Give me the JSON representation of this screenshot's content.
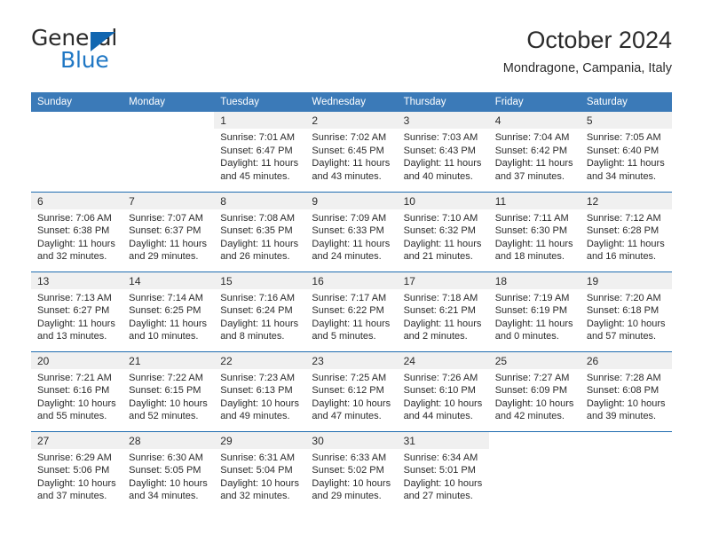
{
  "brand": {
    "name_part1": "General",
    "name_part2": "Blue",
    "triangle_color": "#1166b0",
    "blue_color": "#1f77c4"
  },
  "header": {
    "month_title": "October 2024",
    "location": "Mondragone, Campania, Italy"
  },
  "theme": {
    "header_blue": "#3b7ab8",
    "week_separator": "#1f6cb0",
    "daynum_band": "#f0f0f0"
  },
  "weekday_headers": [
    "Sunday",
    "Monday",
    "Tuesday",
    "Wednesday",
    "Thursday",
    "Friday",
    "Saturday"
  ],
  "weeks": [
    [
      {
        "day": "",
        "sunrise": "",
        "sunset": "",
        "daylight1": "",
        "daylight2": ""
      },
      {
        "day": "",
        "sunrise": "",
        "sunset": "",
        "daylight1": "",
        "daylight2": ""
      },
      {
        "day": "1",
        "sunrise": "Sunrise: 7:01 AM",
        "sunset": "Sunset: 6:47 PM",
        "daylight1": "Daylight: 11 hours",
        "daylight2": "and 45 minutes."
      },
      {
        "day": "2",
        "sunrise": "Sunrise: 7:02 AM",
        "sunset": "Sunset: 6:45 PM",
        "daylight1": "Daylight: 11 hours",
        "daylight2": "and 43 minutes."
      },
      {
        "day": "3",
        "sunrise": "Sunrise: 7:03 AM",
        "sunset": "Sunset: 6:43 PM",
        "daylight1": "Daylight: 11 hours",
        "daylight2": "and 40 minutes."
      },
      {
        "day": "4",
        "sunrise": "Sunrise: 7:04 AM",
        "sunset": "Sunset: 6:42 PM",
        "daylight1": "Daylight: 11 hours",
        "daylight2": "and 37 minutes."
      },
      {
        "day": "5",
        "sunrise": "Sunrise: 7:05 AM",
        "sunset": "Sunset: 6:40 PM",
        "daylight1": "Daylight: 11 hours",
        "daylight2": "and 34 minutes."
      }
    ],
    [
      {
        "day": "6",
        "sunrise": "Sunrise: 7:06 AM",
        "sunset": "Sunset: 6:38 PM",
        "daylight1": "Daylight: 11 hours",
        "daylight2": "and 32 minutes."
      },
      {
        "day": "7",
        "sunrise": "Sunrise: 7:07 AM",
        "sunset": "Sunset: 6:37 PM",
        "daylight1": "Daylight: 11 hours",
        "daylight2": "and 29 minutes."
      },
      {
        "day": "8",
        "sunrise": "Sunrise: 7:08 AM",
        "sunset": "Sunset: 6:35 PM",
        "daylight1": "Daylight: 11 hours",
        "daylight2": "and 26 minutes."
      },
      {
        "day": "9",
        "sunrise": "Sunrise: 7:09 AM",
        "sunset": "Sunset: 6:33 PM",
        "daylight1": "Daylight: 11 hours",
        "daylight2": "and 24 minutes."
      },
      {
        "day": "10",
        "sunrise": "Sunrise: 7:10 AM",
        "sunset": "Sunset: 6:32 PM",
        "daylight1": "Daylight: 11 hours",
        "daylight2": "and 21 minutes."
      },
      {
        "day": "11",
        "sunrise": "Sunrise: 7:11 AM",
        "sunset": "Sunset: 6:30 PM",
        "daylight1": "Daylight: 11 hours",
        "daylight2": "and 18 minutes."
      },
      {
        "day": "12",
        "sunrise": "Sunrise: 7:12 AM",
        "sunset": "Sunset: 6:28 PM",
        "daylight1": "Daylight: 11 hours",
        "daylight2": "and 16 minutes."
      }
    ],
    [
      {
        "day": "13",
        "sunrise": "Sunrise: 7:13 AM",
        "sunset": "Sunset: 6:27 PM",
        "daylight1": "Daylight: 11 hours",
        "daylight2": "and 13 minutes."
      },
      {
        "day": "14",
        "sunrise": "Sunrise: 7:14 AM",
        "sunset": "Sunset: 6:25 PM",
        "daylight1": "Daylight: 11 hours",
        "daylight2": "and 10 minutes."
      },
      {
        "day": "15",
        "sunrise": "Sunrise: 7:16 AM",
        "sunset": "Sunset: 6:24 PM",
        "daylight1": "Daylight: 11 hours",
        "daylight2": "and 8 minutes."
      },
      {
        "day": "16",
        "sunrise": "Sunrise: 7:17 AM",
        "sunset": "Sunset: 6:22 PM",
        "daylight1": "Daylight: 11 hours",
        "daylight2": "and 5 minutes."
      },
      {
        "day": "17",
        "sunrise": "Sunrise: 7:18 AM",
        "sunset": "Sunset: 6:21 PM",
        "daylight1": "Daylight: 11 hours",
        "daylight2": "and 2 minutes."
      },
      {
        "day": "18",
        "sunrise": "Sunrise: 7:19 AM",
        "sunset": "Sunset: 6:19 PM",
        "daylight1": "Daylight: 11 hours",
        "daylight2": "and 0 minutes."
      },
      {
        "day": "19",
        "sunrise": "Sunrise: 7:20 AM",
        "sunset": "Sunset: 6:18 PM",
        "daylight1": "Daylight: 10 hours",
        "daylight2": "and 57 minutes."
      }
    ],
    [
      {
        "day": "20",
        "sunrise": "Sunrise: 7:21 AM",
        "sunset": "Sunset: 6:16 PM",
        "daylight1": "Daylight: 10 hours",
        "daylight2": "and 55 minutes."
      },
      {
        "day": "21",
        "sunrise": "Sunrise: 7:22 AM",
        "sunset": "Sunset: 6:15 PM",
        "daylight1": "Daylight: 10 hours",
        "daylight2": "and 52 minutes."
      },
      {
        "day": "22",
        "sunrise": "Sunrise: 7:23 AM",
        "sunset": "Sunset: 6:13 PM",
        "daylight1": "Daylight: 10 hours",
        "daylight2": "and 49 minutes."
      },
      {
        "day": "23",
        "sunrise": "Sunrise: 7:25 AM",
        "sunset": "Sunset: 6:12 PM",
        "daylight1": "Daylight: 10 hours",
        "daylight2": "and 47 minutes."
      },
      {
        "day": "24",
        "sunrise": "Sunrise: 7:26 AM",
        "sunset": "Sunset: 6:10 PM",
        "daylight1": "Daylight: 10 hours",
        "daylight2": "and 44 minutes."
      },
      {
        "day": "25",
        "sunrise": "Sunrise: 7:27 AM",
        "sunset": "Sunset: 6:09 PM",
        "daylight1": "Daylight: 10 hours",
        "daylight2": "and 42 minutes."
      },
      {
        "day": "26",
        "sunrise": "Sunrise: 7:28 AM",
        "sunset": "Sunset: 6:08 PM",
        "daylight1": "Daylight: 10 hours",
        "daylight2": "and 39 minutes."
      }
    ],
    [
      {
        "day": "27",
        "sunrise": "Sunrise: 6:29 AM",
        "sunset": "Sunset: 5:06 PM",
        "daylight1": "Daylight: 10 hours",
        "daylight2": "and 37 minutes."
      },
      {
        "day": "28",
        "sunrise": "Sunrise: 6:30 AM",
        "sunset": "Sunset: 5:05 PM",
        "daylight1": "Daylight: 10 hours",
        "daylight2": "and 34 minutes."
      },
      {
        "day": "29",
        "sunrise": "Sunrise: 6:31 AM",
        "sunset": "Sunset: 5:04 PM",
        "daylight1": "Daylight: 10 hours",
        "daylight2": "and 32 minutes."
      },
      {
        "day": "30",
        "sunrise": "Sunrise: 6:33 AM",
        "sunset": "Sunset: 5:02 PM",
        "daylight1": "Daylight: 10 hours",
        "daylight2": "and 29 minutes."
      },
      {
        "day": "31",
        "sunrise": "Sunrise: 6:34 AM",
        "sunset": "Sunset: 5:01 PM",
        "daylight1": "Daylight: 10 hours",
        "daylight2": "and 27 minutes."
      },
      {
        "day": "",
        "sunrise": "",
        "sunset": "",
        "daylight1": "",
        "daylight2": ""
      },
      {
        "day": "",
        "sunrise": "",
        "sunset": "",
        "daylight1": "",
        "daylight2": ""
      }
    ]
  ]
}
